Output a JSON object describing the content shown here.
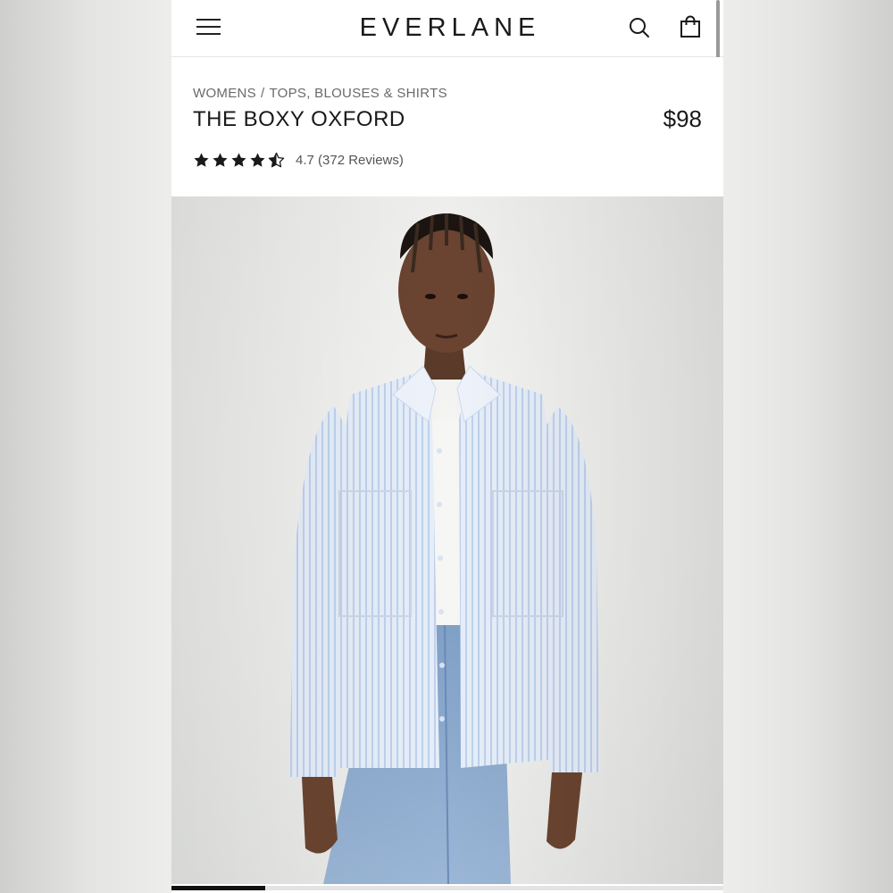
{
  "header": {
    "brand": "EVERLANE",
    "menu_icon": "hamburger-menu-icon",
    "search_icon": "search-icon",
    "bag_icon": "shopping-bag-icon"
  },
  "breadcrumb": {
    "items": [
      "WOMENS",
      "TOPS, BLOUSES & SHIRTS"
    ],
    "separator": "/"
  },
  "product": {
    "name": "THE BOXY OXFORD",
    "price": "$98",
    "rating": {
      "stars": 4.5,
      "max_stars": 5,
      "text": "4.7 (372 Reviews)"
    }
  },
  "gallery": {
    "image_description": "Model wearing light blue striped oversized oxford shirt over white top and light wash jeans",
    "progress": 0.17
  },
  "colors": {
    "page_background": "#ffffff",
    "outer_background": "#ededeb",
    "text_primary": "#1a1a1a",
    "text_secondary": "#6a6a6a",
    "star": "#1a1a1a"
  }
}
